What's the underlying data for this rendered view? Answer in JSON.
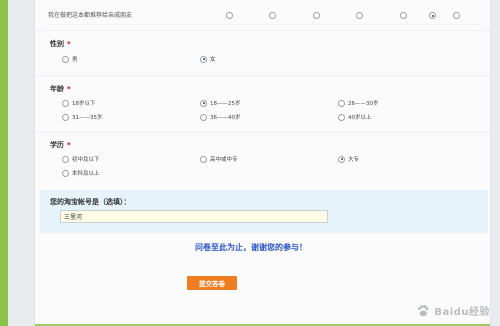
{
  "matrix": {
    "label": "我在做把这本都推荐给亲戚朋友",
    "selected_index": 5
  },
  "gender": {
    "title": "性别",
    "required_mark": "*",
    "options": [
      "男",
      "女"
    ],
    "selected_index": 1
  },
  "age": {
    "title": "年龄",
    "required_mark": "*",
    "options": [
      "18岁以下",
      "18——25岁",
      "26——30岁",
      "31——35岁",
      "36——40岁",
      "40岁以上"
    ],
    "selected_index": 1
  },
  "education": {
    "title": "学历",
    "required_mark": "*",
    "options": [
      "初中及以下",
      "高中或中专",
      "大专",
      "本科及以上"
    ],
    "selected_index": 2
  },
  "account": {
    "title": "您的淘宝帐号是（选填）：",
    "value": "三里河"
  },
  "thanks": "问卷至此为止，谢谢您的参与！",
  "submit_label": "提交答卷",
  "watermark": "Baidu经验",
  "colors": {
    "accent_orange": "#ef7d22",
    "link_blue": "#2a55c8",
    "required_red": "#d0021b",
    "left_bar_green": "#8bc34a"
  }
}
